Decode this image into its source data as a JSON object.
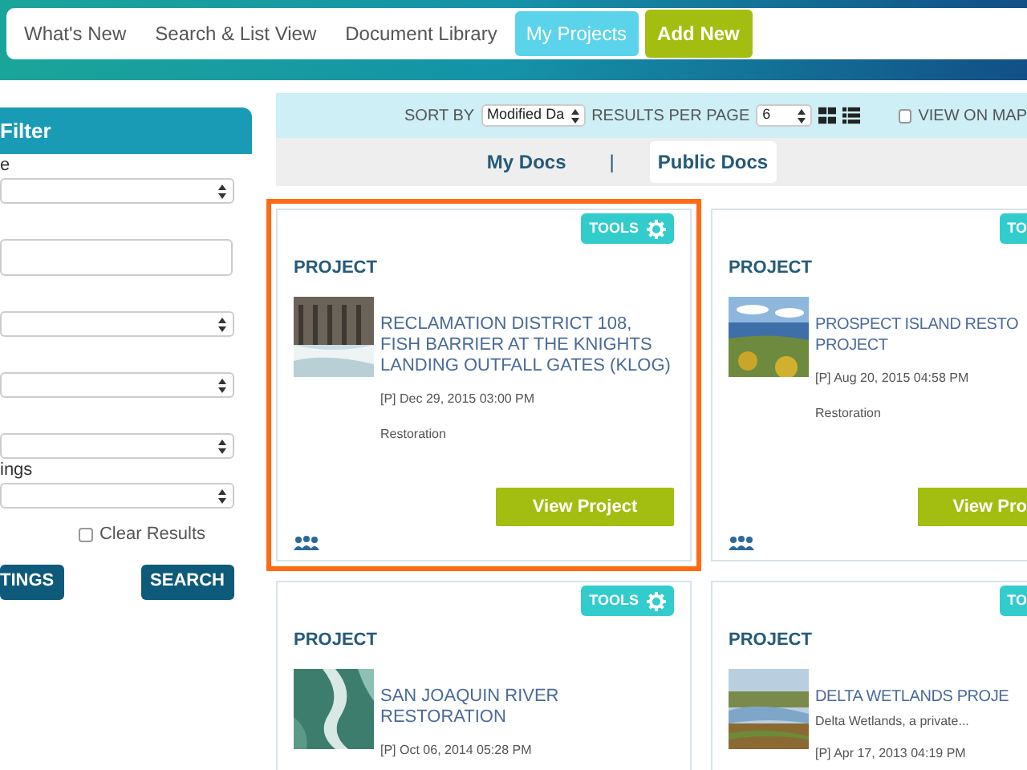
{
  "nav": {
    "links": [
      {
        "label": "What's New",
        "selected": false
      },
      {
        "label": "Search & List View",
        "selected": false
      },
      {
        "label": "Document Library",
        "selected": false
      },
      {
        "label": "My Projects",
        "selected": true
      }
    ],
    "add_button": "Add New"
  },
  "filter": {
    "title": "Filter",
    "fields": [
      {
        "label": "e",
        "kind": "select"
      },
      {
        "kind": "text"
      },
      {
        "kind": "select"
      },
      {
        "kind": "select"
      },
      {
        "kind": "select"
      },
      {
        "label": "ings",
        "kind": "select"
      }
    ],
    "clear_results": {
      "label": "Clear Results",
      "checked": false
    },
    "buttons": [
      "TINGS",
      "SEARCH"
    ]
  },
  "toolbar": {
    "sort_by_label": "SORT BY",
    "sort_by": "Modified Da",
    "results_label": "RESULTS PER PAGE",
    "results": "6",
    "view_on_map": {
      "label": "VIEW ON MAP",
      "checked": false
    }
  },
  "doc_tabs": {
    "tabs": [
      {
        "label": "My Docs",
        "selected": false
      },
      {
        "label": "Public Docs",
        "selected": true
      }
    ],
    "separator": "|"
  },
  "cards": [
    {
      "type_label": "PROJECT",
      "tools": "TOOLS",
      "title": "RECLAMATION DISTRICT 108, FISH BARRIER AT THE KNIGHTS LANDING OUTFALL GATES (KLOG)",
      "date": "[P] Dec 29, 2015 03:00 PM",
      "category": "Restoration",
      "button": "View Project",
      "highlighted": true
    },
    {
      "type_label": "PROJECT",
      "tools": "TO",
      "title_lines": [
        "PROSPECT ISLAND RESTO",
        "PROJECT"
      ],
      "date": "[P] Aug 20, 2015 04:58 PM",
      "category": "Restoration",
      "button": "View Pro",
      "highlighted": false
    },
    {
      "type_label": "PROJECT",
      "tools": "TOOLS",
      "title": "SAN JOAQUIN RIVER RESTORATION",
      "date": "[P] Oct 06, 2014 05:28 PM",
      "highlighted": false
    },
    {
      "type_label": "PROJECT",
      "tools": "TO",
      "title_lines": [
        "DELTA WETLANDS PROJE"
      ],
      "description": "Delta Wetlands, a private...",
      "date": "[P] Apr 17, 2013 04:19 PM",
      "highlighted": false
    }
  ]
}
